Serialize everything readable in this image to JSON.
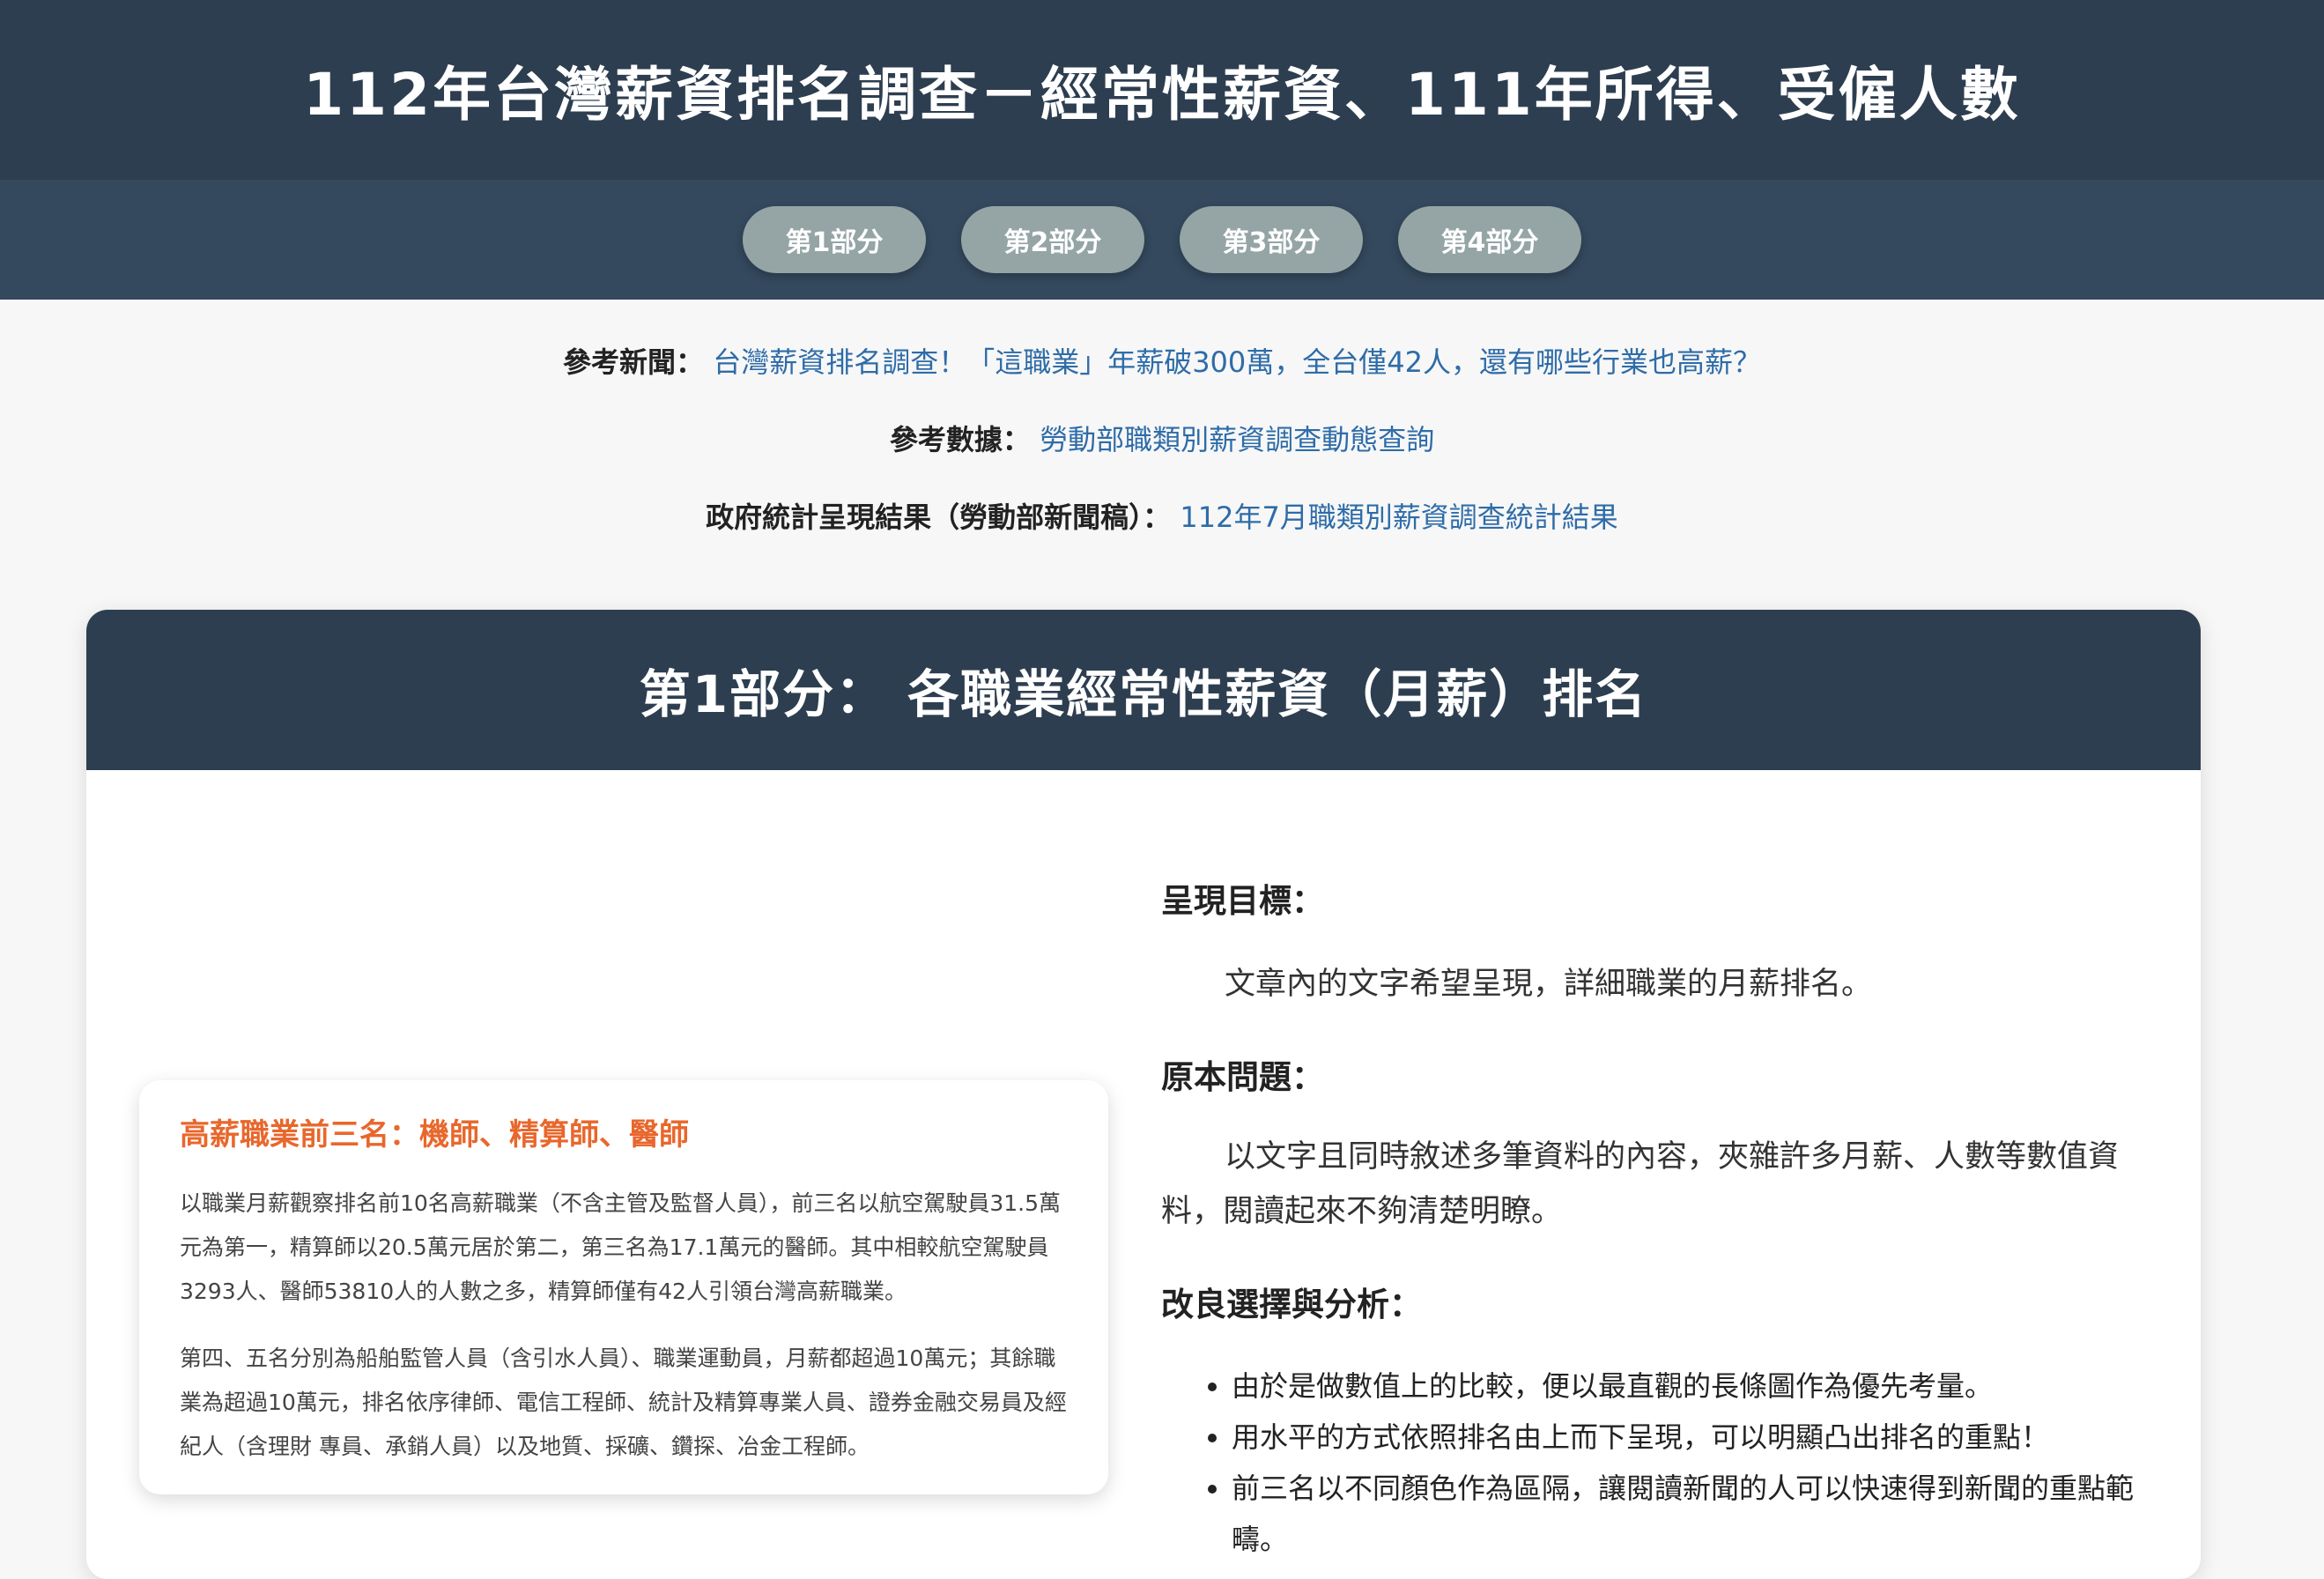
{
  "header": {
    "title": "112年台灣薪資排名調查－經常性薪資、111年所得、受僱人數"
  },
  "nav": {
    "items": [
      "第1部分",
      "第2部分",
      "第3部分",
      "第4部分"
    ]
  },
  "references": [
    {
      "label": "參考新聞：",
      "link": "台灣薪資排名調查！「這職業」年薪破300萬，全台僅42人，還有哪些行業也高薪？"
    },
    {
      "label": "參考數據：",
      "link": "勞動部職類別薪資調查動態查詢"
    },
    {
      "label": "政府統計呈現結果（勞動部新聞稿）：",
      "link": "112年7月職類別薪資調查統計結果"
    }
  ],
  "section1": {
    "title": "第1部分： 各職業經常性薪資（月薪）排名",
    "insight": {
      "title": "高薪職業前三名：機師、精算師、醫師",
      "para1": "以職業月薪觀察排名前10名高薪職業（不含主管及監督人員），前三名以航空駕駛員31.5萬元為第一，精算師以20.5萬元居於第二，第三名為17.1萬元的醫師。其中相較航空駕駛員3293人、醫師53810人的人數之多，精算師僅有42人引領台灣高薪職業。",
      "para2": "第四、五名分別為船舶監管人員（含引水人員）、職業運動員，月薪都超過10萬元；其餘職業為超過10萬元，排名依序律師、電信工程師、統計及精算專業人員、證券金融交易員及經紀人（含理財 專員、承銷人員）以及地質、採礦、鑽探、冶金工程師。"
    },
    "goal_title": "呈現目標：",
    "goal_text": "文章內的文字希望呈現，詳細職業的月薪排名。",
    "problem_title": "原本問題：",
    "problem_text": "以文字且同時敘述多筆資料的內容，夾雜許多月薪、人數等數值資料，閱讀起來不夠清楚明瞭。",
    "improve_title": "改良選擇與分析：",
    "improve_items": [
      "由於是做數值上的比較，便以最直觀的長條圖作為優先考量。",
      "用水平的方式依照排名由上而下呈現，可以明顯凸出排名的重點！",
      "前三名以不同顏色作為區隔，讓閱讀新聞的人可以快速得到新聞的重點範疇。"
    ]
  },
  "colors": {
    "header_bg": "#2d3e50",
    "nav_bg": "#34495e",
    "nav_button": "#95a5a6",
    "link": "#2e6ca8",
    "accent_orange": "#e8672c"
  }
}
